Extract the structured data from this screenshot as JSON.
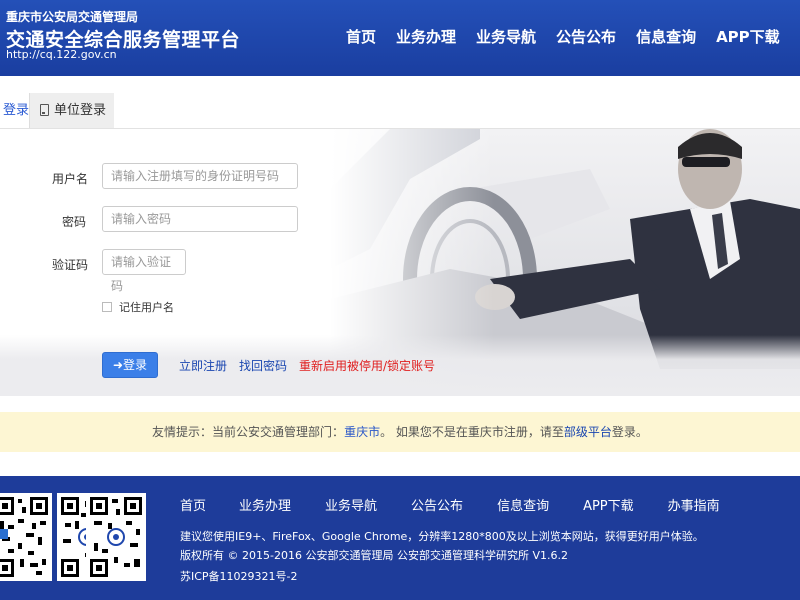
{
  "header": {
    "sub_title": "重庆市公安局交通管理局",
    "title": "交通安全综合服务管理平台",
    "url": "http://cq.122.gov.cn",
    "nav": [
      "首页",
      "业务办理",
      "业务导航",
      "公告公布",
      "信息查询",
      "APP下载"
    ]
  },
  "tabs": {
    "personal": "登录",
    "unit": "单位登录"
  },
  "form": {
    "username_label": "用户名",
    "username_placeholder": "请输入注册填写的身份证明号码",
    "password_label": "密码",
    "password_placeholder": "请输入密码",
    "captcha_label": "验证码",
    "captcha_placeholder": "请输入验证码",
    "remember_label": "记住用户名",
    "login_button": "➜登录",
    "register_link": "立即注册",
    "recover_link": "找回密码",
    "reactivate_link": "重新启用被停用/锁定账号"
  },
  "notice": {
    "prefix": "友情提示：当前公安交通管理部门：",
    "city": "重庆市",
    "middle": "。 如果您不是在重庆市注册，请至",
    "link": "部级平台",
    "suffix": "登录。"
  },
  "footer": {
    "nav": [
      "首页",
      "业务办理",
      "业务导航",
      "公告公布",
      "信息查询",
      "APP下载",
      "办事指南"
    ],
    "line1": "建议您使用IE9+、FireFox、Google Chrome，分辨率1280*800及以上浏览本网站，获得更好用户体验。",
    "line2": "版权所有 © 2015-2016 公安部交通管理局 公安部交通管理科学研究所 V1.6.2",
    "line3": "苏ICP备11029321号-2"
  },
  "colors": {
    "header_bg": "#1f47ad",
    "footer_bg": "#1e3c9a",
    "primary_button": "#3b7fe8",
    "link_blue": "#1a46b0",
    "link_red": "#e02020",
    "notice_bg": "#fdf6d3"
  }
}
